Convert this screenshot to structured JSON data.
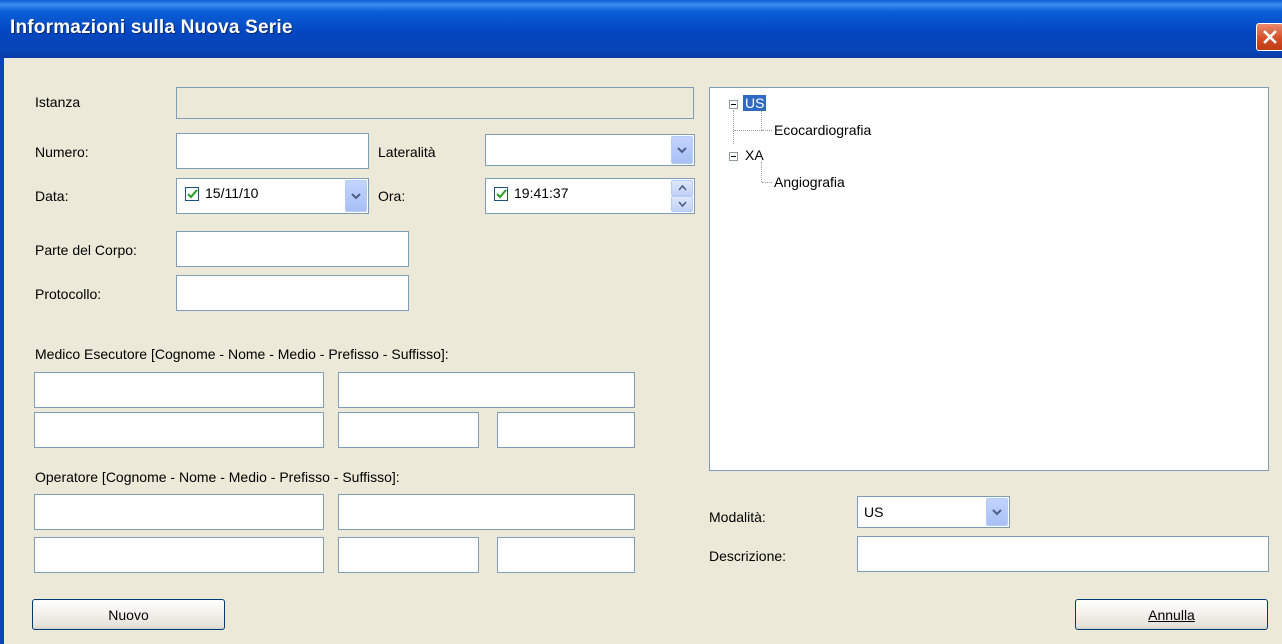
{
  "window": {
    "title": "Informazioni sulla Nuova Serie"
  },
  "icons": {
    "close": "close-icon",
    "dropdown": "chevron-down-icon",
    "spin_up": "arrow-up-icon",
    "spin_down": "arrow-down-icon",
    "check": "checkmark-icon",
    "tree_collapse": "minus-icon"
  },
  "form": {
    "istanza_label": "Istanza",
    "istanza_value": "",
    "numero_label": "Numero:",
    "numero_value": "",
    "lateralita_label": "Lateralità",
    "lateralita_value": "",
    "data_label": "Data:",
    "data_value": "15/11/10",
    "data_checked": true,
    "ora_label": "Ora:",
    "ora_value": "19:41:37",
    "ora_checked": true,
    "parte_label": "Parte del Corpo:",
    "parte_value": "",
    "protocollo_label": "Protocollo:",
    "protocollo_value": "",
    "medico_label": "Medico Esecutore [Cognome - Nome - Medio - Prefisso - Suffisso]:",
    "operatore_label": "Operatore [Cognome - Nome - Medio - Prefisso - Suffisso]:"
  },
  "tree": {
    "nodes": [
      {
        "label": "US",
        "selected": true,
        "children": [
          {
            "label": "Ecocardiografia"
          }
        ]
      },
      {
        "label": "XA",
        "selected": false,
        "children": [
          {
            "label": "Angiografia"
          }
        ]
      }
    ]
  },
  "modalita": {
    "label": "Modalità:",
    "value": "US"
  },
  "descrizione": {
    "label": "Descrizione:",
    "value": ""
  },
  "buttons": {
    "nuovo": "Nuovo",
    "annulla": "Annulla"
  },
  "colors": {
    "titlebar": "#0a5fd6",
    "selection": "#316ac5",
    "face": "#ece9d8",
    "border": "#7f9db9"
  }
}
